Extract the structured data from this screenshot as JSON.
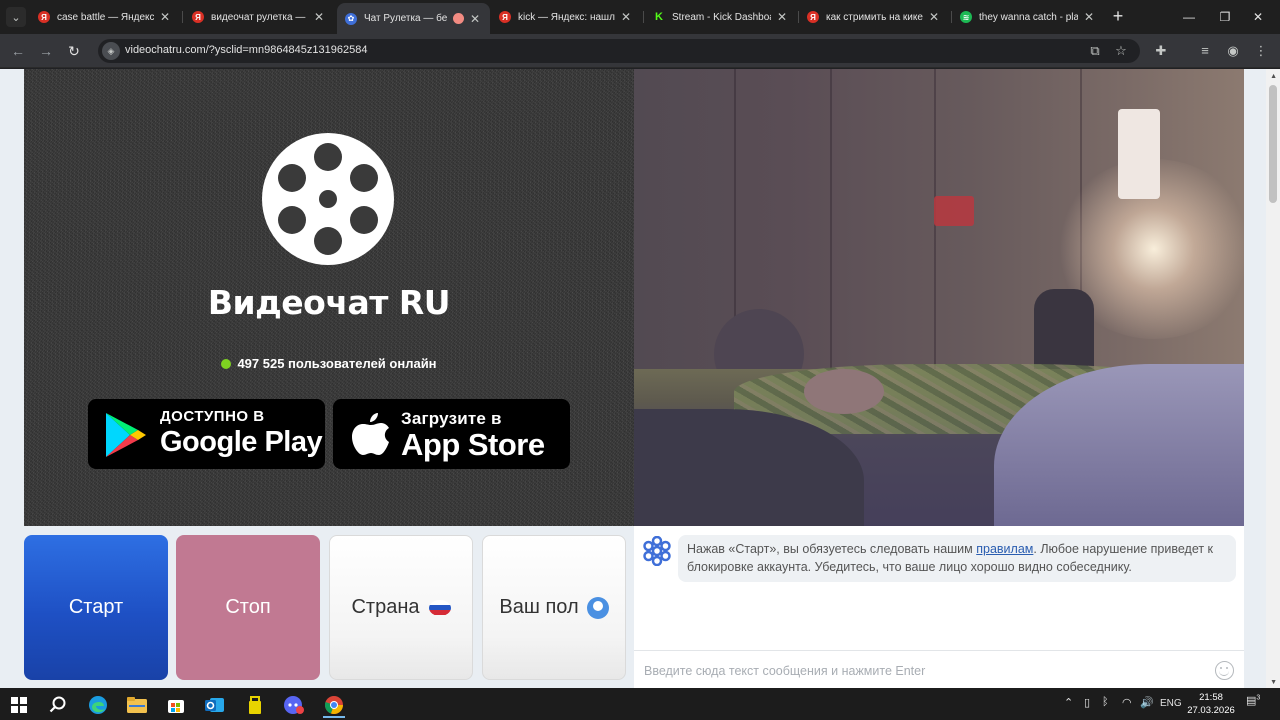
{
  "browser": {
    "tabs": [
      {
        "title": "case battle — Яндекс",
        "fav_char": "Я",
        "fav_color": "#d93025"
      },
      {
        "title": "видеочат рулетка — Я",
        "fav_char": "Я",
        "fav_color": "#d93025"
      },
      {
        "title": "Чат Рулетка — бе",
        "fav_char": "",
        "fav_color": "#3f6fd8",
        "active": true
      },
      {
        "title": "kick — Яндекс: нашло",
        "fav_char": "Я",
        "fav_color": "#d93025"
      },
      {
        "title": "Stream - Kick Dashboa",
        "fav_char": "K",
        "fav_color": "#53fc18"
      },
      {
        "title": "как стримить на кике",
        "fav_char": "Я",
        "fav_color": "#d93025"
      },
      {
        "title": "they wanna catch - pla",
        "fav_char": "",
        "fav_color": "#1db954"
      }
    ],
    "url": "videochatru.com/?ysclid=mn9864845z131962584"
  },
  "page": {
    "brand": "Видеочат RU",
    "online_count": "497 525 пользователей онлайн",
    "google_play": {
      "small": "ДОСТУПНО В",
      "big": "Google Play"
    },
    "app_store": {
      "small": "Загрузите в",
      "big": "App Store"
    },
    "buttons": {
      "start": "Старт",
      "stop": "Стоп",
      "country": "Страна",
      "gender": "Ваш пол"
    },
    "chat": {
      "notice_before_link": "Нажав «Старт», вы обязуетесь следовать нашим ",
      "notice_link": "правилам",
      "notice_after_link": ". Любое нарушение приведет к блокировке аккаунта. Убедитесь, что ваше лицо хорошо видно собеседнику.",
      "input_placeholder": "Введите сюда текст сообщения и нажмите Enter"
    }
  },
  "taskbar": {
    "lang": "ENG",
    "time": "21:58",
    "date": "27.03.2026",
    "notification_count": "3"
  },
  "colors": {
    "start": "#1e50c4",
    "stop": "#c17992",
    "online_dot": "#7ed321",
    "link": "#2a5db0"
  }
}
